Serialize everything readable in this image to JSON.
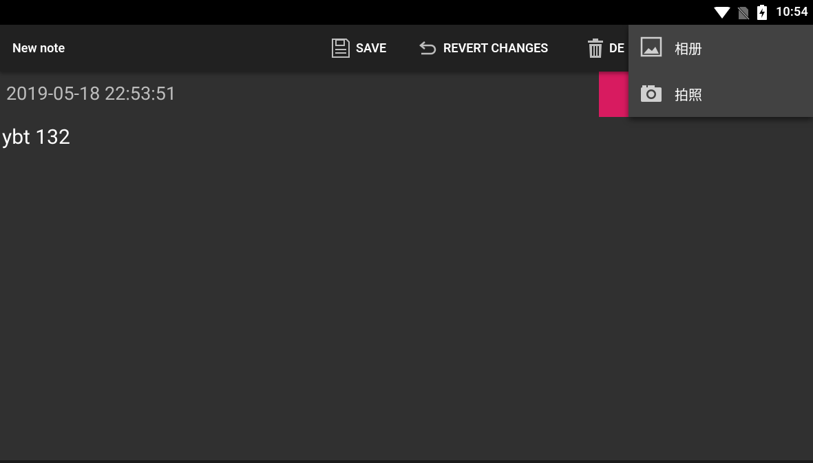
{
  "status_bar": {
    "time": "10:54",
    "icons": [
      "wifi-icon",
      "no-sim-icon",
      "battery-charging-icon"
    ]
  },
  "action_bar": {
    "title": "New note",
    "save_label": "SAVE",
    "revert_label": "REVERT CHANGES",
    "delete_label": "DE"
  },
  "note": {
    "timestamp": "2019-05-18 22:53:51",
    "text": "ybt 132"
  },
  "popup_menu": {
    "items": [
      {
        "label": "相册",
        "icon": "image-icon"
      },
      {
        "label": "拍照",
        "icon": "camera-icon"
      }
    ]
  },
  "colors": {
    "background": "#303030",
    "action_bar": "#212121",
    "accent": "#d81b60",
    "menu": "#424242"
  }
}
